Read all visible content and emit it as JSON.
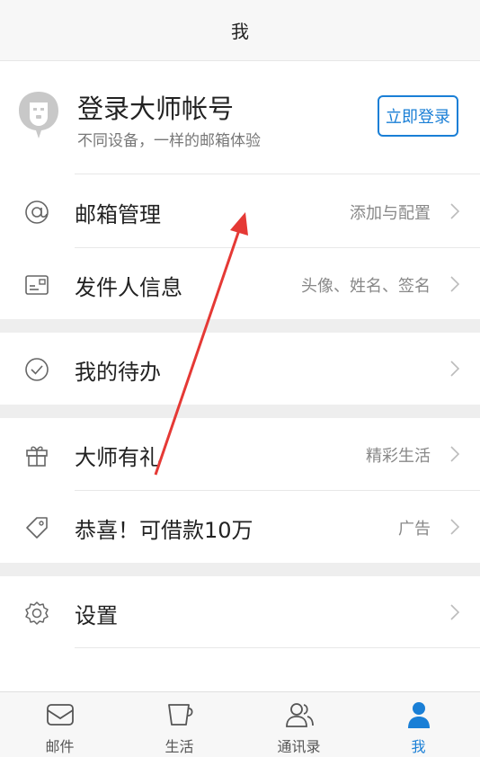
{
  "header": {
    "title": "我"
  },
  "profile": {
    "title": "登录大师帐号",
    "subtitle": "不同设备，一样的邮箱体验",
    "login_label": "立即登录"
  },
  "menu": [
    {
      "label": "邮箱管理",
      "value": "添加与配置",
      "icon": "at-icon"
    },
    {
      "label": "发件人信息",
      "value": "头像、姓名、签名",
      "icon": "id-card-icon"
    },
    {
      "label": "我的待办",
      "value": "",
      "icon": "check-circle-icon"
    },
    {
      "label": "大师有礼",
      "value": "精彩生活",
      "icon": "gift-icon"
    },
    {
      "label": "恭喜！可借款10万",
      "value": "广告",
      "icon": "tag-icon"
    },
    {
      "label": "设置",
      "value": "",
      "icon": "gear-icon"
    }
  ],
  "tabs": [
    {
      "label": "邮件",
      "icon": "mail-icon"
    },
    {
      "label": "生活",
      "icon": "cup-icon"
    },
    {
      "label": "通讯录",
      "icon": "contacts-icon"
    },
    {
      "label": "我",
      "icon": "person-icon"
    }
  ],
  "colors": {
    "accent": "#1a7fd6",
    "annotation_arrow": "#e53935"
  }
}
